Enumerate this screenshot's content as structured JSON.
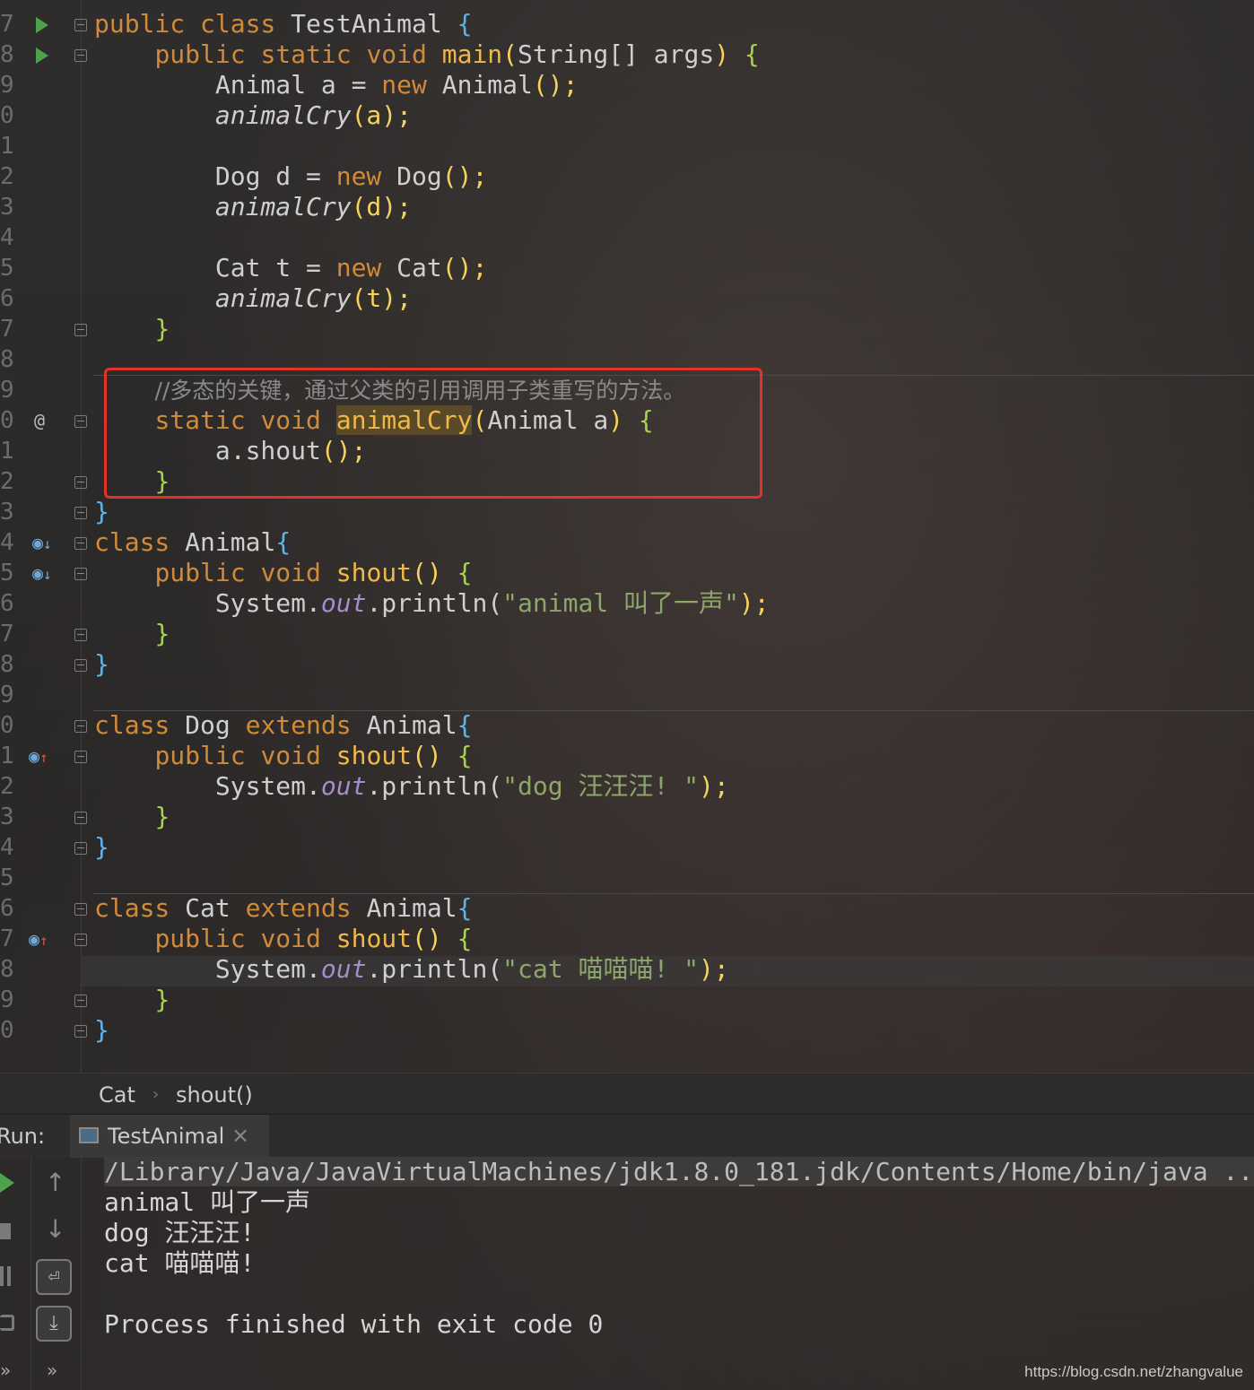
{
  "editor": {
    "line_numbers": [
      "7",
      "8",
      "9",
      "0",
      "1",
      "2",
      "3",
      "4",
      "5",
      "6",
      "7",
      "8",
      "9",
      "0",
      "1",
      "2",
      "3",
      "4",
      "5",
      "6",
      "7",
      "8",
      "9",
      "0",
      "1",
      "2",
      "3",
      "4",
      "5",
      "6",
      "7",
      "8",
      "9",
      "0"
    ],
    "code": {
      "l1": {
        "kw": "public class ",
        "name": "TestAnimal ",
        "brace": "{"
      },
      "l2": {
        "kw": "public static void ",
        "fn": "main",
        "p1": "(",
        "args": "String[] args",
        "p2": ") ",
        "brace": "{"
      },
      "l3": {
        "a": "Animal a = ",
        "kw": "new ",
        "b": "Animal",
        "p": "();"
      },
      "l4": {
        "fn": "animalCry",
        "p": "(a);"
      },
      "l6": {
        "a": "Dog d = ",
        "kw": "new ",
        "b": "Dog",
        "p": "();"
      },
      "l7": {
        "fn": "animalCry",
        "p": "(d);"
      },
      "l9": {
        "a": "Cat t = ",
        "kw": "new ",
        "b": "Cat",
        "p": "();"
      },
      "l10": {
        "fn": "animalCry",
        "p": "(t);"
      },
      "l11": {
        "brace": "}"
      },
      "l13": {
        "comment": "//多态的关键，通过父类的引用调用子类重写的方法。"
      },
      "l14": {
        "kw": "static void ",
        "fn": "animalCry",
        "p1": "(",
        "param": "Animal a",
        "p2": ") ",
        "brace": "{"
      },
      "l15": {
        "a": "a.shout",
        "p": "();"
      },
      "l16": {
        "brace": "}"
      },
      "l17": {
        "brace": "}"
      },
      "l18": {
        "kw": "class ",
        "name": "Animal",
        "brace": "{"
      },
      "l19": {
        "kw": "public void ",
        "fn": "shout",
        "p": "() ",
        "brace": "{"
      },
      "l20": {
        "a": "System.",
        "out": "out",
        "b": ".println(",
        "s": "\"animal 叫了一声\"",
        "e": ");"
      },
      "l21": {
        "brace": "}"
      },
      "l22": {
        "brace": "}"
      },
      "l24": {
        "kw": "class ",
        "name": "Dog ",
        "kw2": "extends ",
        "base": "Animal",
        "brace": "{"
      },
      "l25": {
        "kw": "public void ",
        "fn": "shout",
        "p": "() ",
        "brace": "{"
      },
      "l26": {
        "a": "System.",
        "out": "out",
        "b": ".println(",
        "s": "\"dog 汪汪汪! \"",
        "e": ");"
      },
      "l27": {
        "brace": "}"
      },
      "l28": {
        "brace": "}"
      },
      "l30": {
        "kw": "class ",
        "name": "Cat ",
        "kw2": "extends ",
        "base": "Animal",
        "brace": "{"
      },
      "l31": {
        "kw": "public void ",
        "fn": "shout",
        "p": "() ",
        "brace": "{"
      },
      "l32": {
        "a": "System.",
        "out": "out",
        "b": ".println(",
        "s": "\"cat 喵喵喵! \"",
        "e": ");"
      },
      "l33": {
        "brace": "}"
      },
      "l34": {
        "brace": "}"
      }
    },
    "gutter_at": "@"
  },
  "breadcrumb": {
    "class": "Cat",
    "sep": "›",
    "method": "shout()"
  },
  "run": {
    "label": "Run:",
    "tab": "TestAnimal",
    "close": "×",
    "console": [
      "/Library/Java/JavaVirtualMachines/jdk1.8.0_181.jdk/Contents/Home/bin/java ...",
      "animal 叫了一声",
      "dog 汪汪汪!",
      "cat 喵喵喵!",
      "",
      "Process finished with exit code 0"
    ],
    "more": "»"
  },
  "watermark": "https://blog.csdn.net/zhangvalue",
  "colors": {
    "highlight_box": "#e2332a",
    "keyword": "#d08a3a",
    "function": "#f0b84a",
    "string": "#8ea56b"
  }
}
